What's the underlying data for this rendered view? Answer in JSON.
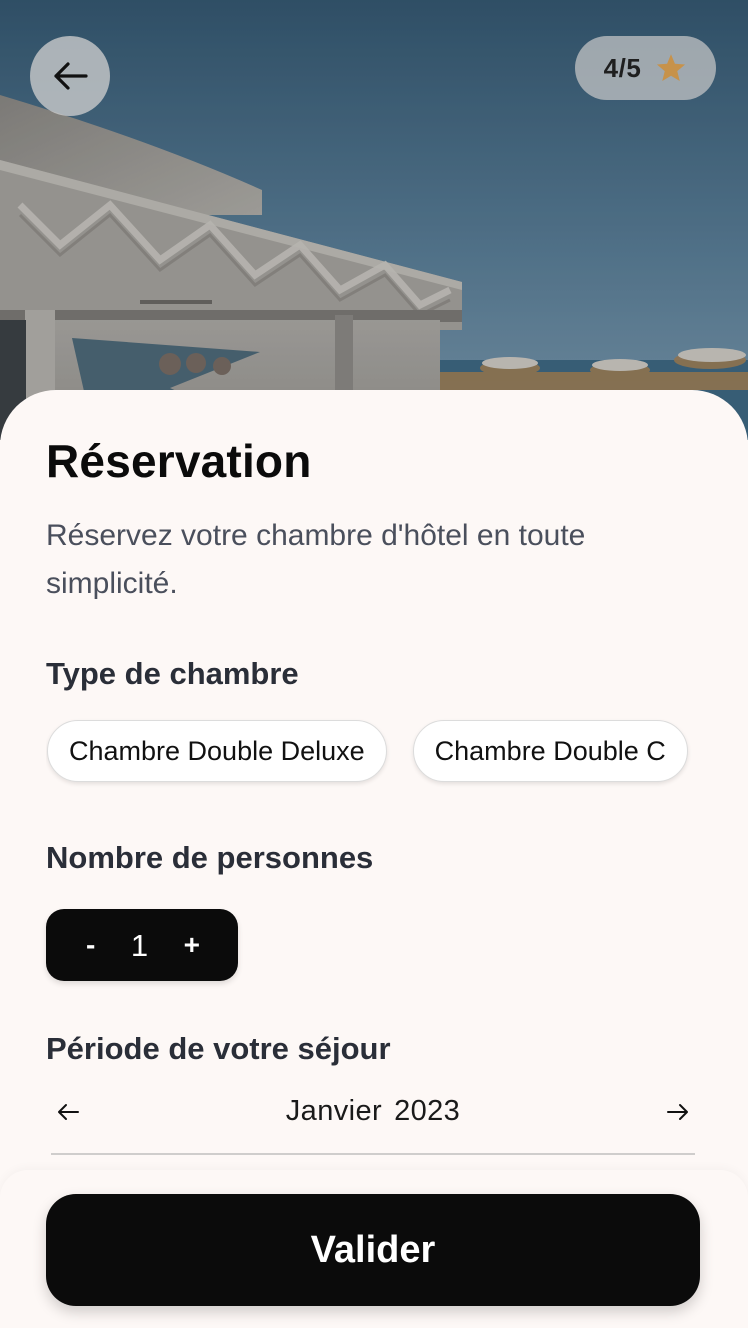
{
  "header": {
    "back_icon": "arrow-left-icon",
    "rating": {
      "text": "4/5",
      "value": 4,
      "max": 5,
      "icon": "star-icon",
      "star_color": "#c7924a"
    }
  },
  "reservation": {
    "title": "Réservation",
    "subtitle": "Réservez votre chambre d'hôtel en toute simplicité.",
    "room_type": {
      "label": "Type de chambre",
      "options": [
        "Chambre Double Deluxe",
        "Chambre Double C"
      ]
    },
    "persons": {
      "label": "Nombre de personnes",
      "decrement": "-",
      "value": "1",
      "increment": "+"
    },
    "period": {
      "label": "Période de votre séjour",
      "month": "Janvier",
      "year": "2023",
      "prev_icon": "arrow-left-icon",
      "next_icon": "arrow-right-icon"
    }
  },
  "footer": {
    "validate_label": "Valider"
  },
  "colors": {
    "accent": "#0b0b0b",
    "background": "#fdf8f6",
    "text_secondary": "#4a4f5c"
  }
}
